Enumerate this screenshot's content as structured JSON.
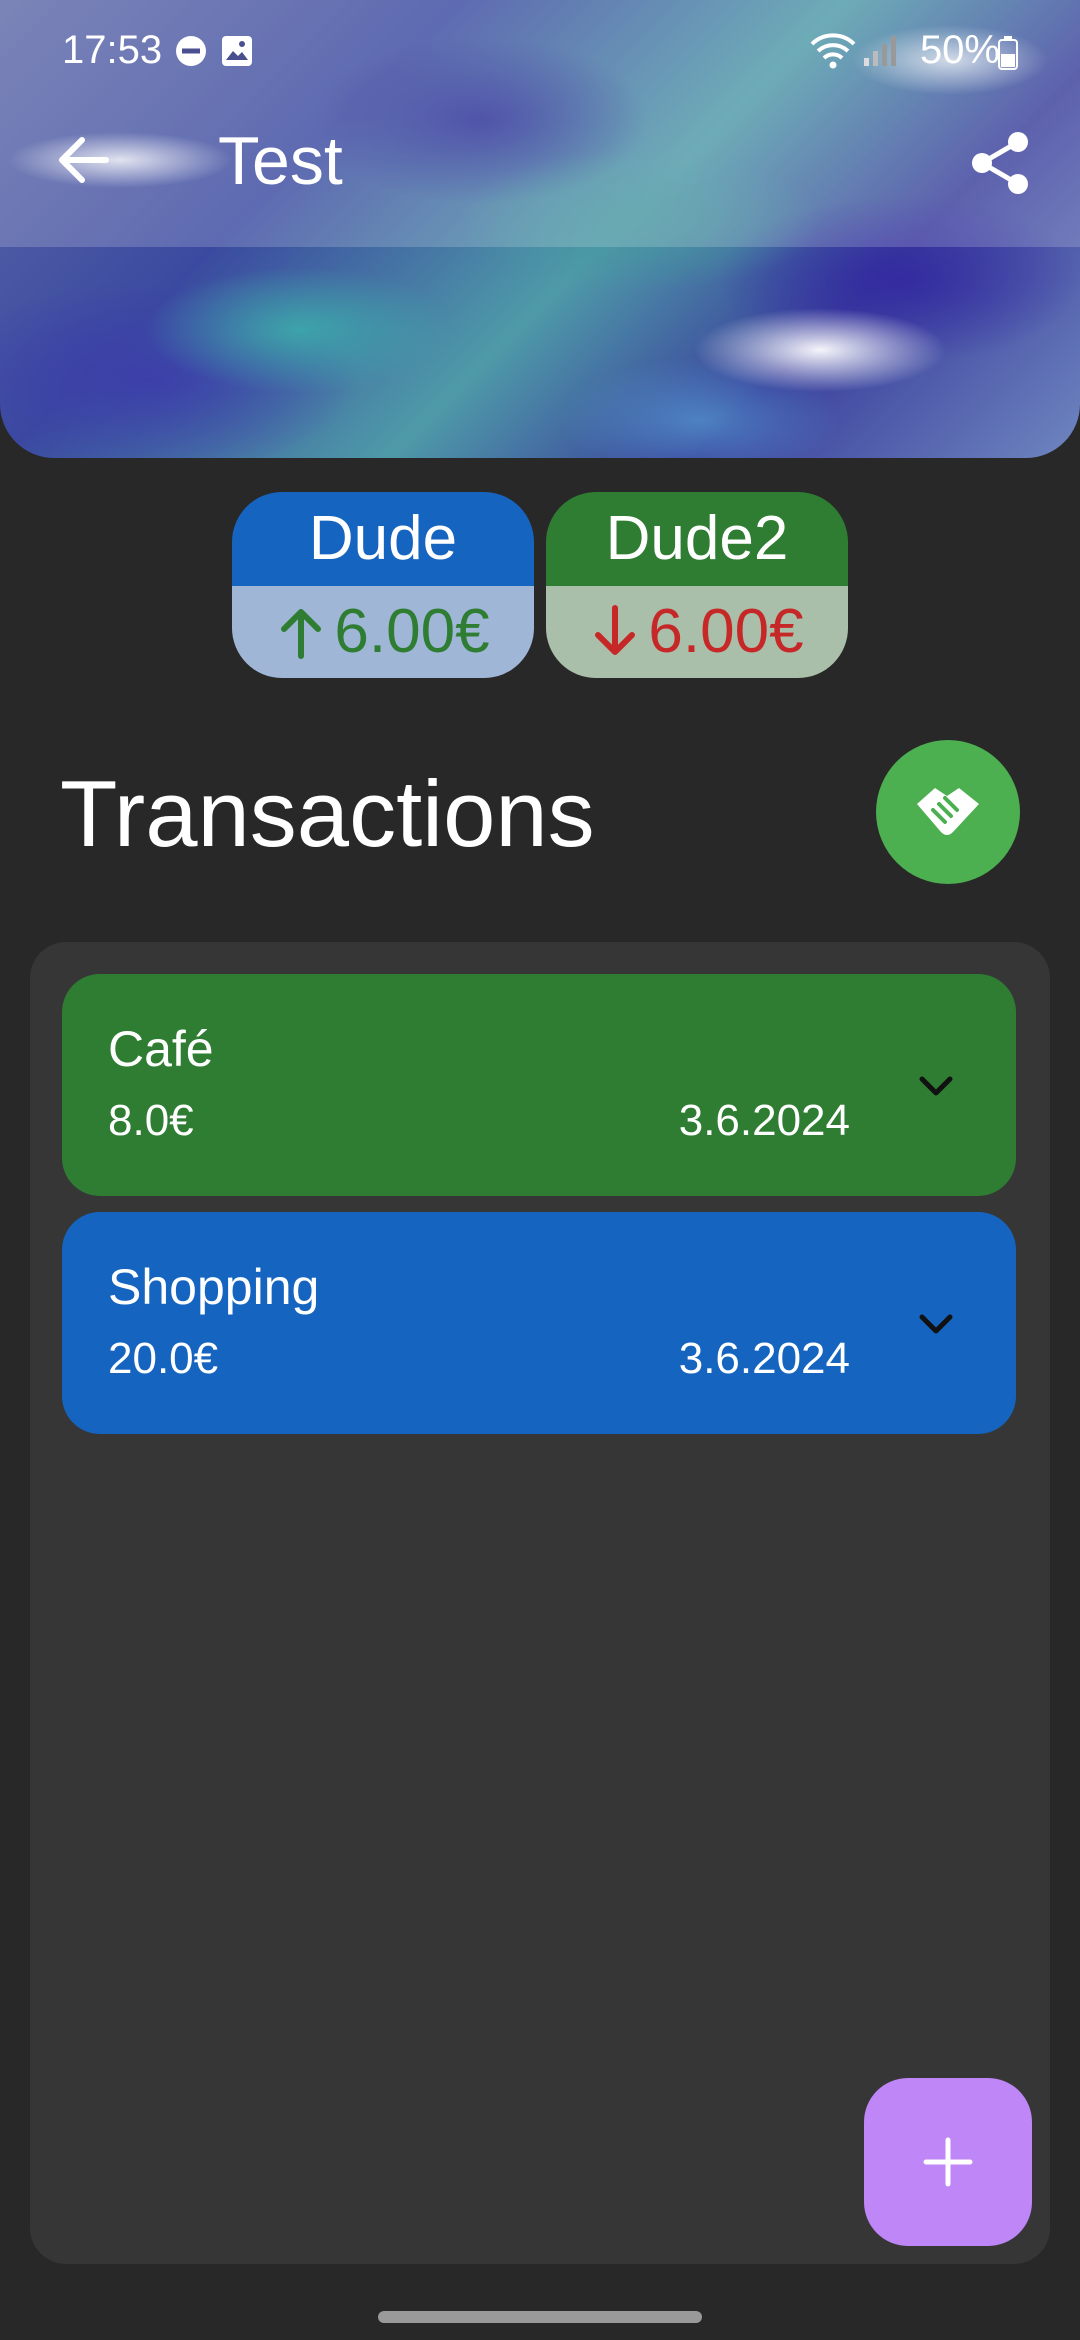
{
  "status_bar": {
    "time": "17:53",
    "battery": "50%",
    "icons": [
      "dnd-icon",
      "image-icon",
      "wifi-icon",
      "signal-icon",
      "battery-icon"
    ]
  },
  "app_bar": {
    "title": "Test",
    "back_icon": "arrow-left-icon",
    "share_icon": "share-icon"
  },
  "balances": [
    {
      "name": "Dude",
      "amount": "6.00€",
      "direction": "up",
      "name_color": "#1565c0",
      "amount_color": "#2e7d32"
    },
    {
      "name": "Dude2",
      "amount": "6.00€",
      "direction": "down",
      "name_color": "#2e7d32",
      "amount_color": "#c62828"
    }
  ],
  "section": {
    "title": "Transactions",
    "settle_icon": "handshake-icon",
    "settle_color": "#4caf50"
  },
  "transactions": [
    {
      "title": "Café",
      "amount": "8.0€",
      "date": "3.6.2024",
      "color": "#2e7d32"
    },
    {
      "title": "Shopping",
      "amount": "20.0€",
      "date": "3.6.2024",
      "color": "#1565c0"
    }
  ],
  "fab": {
    "icon": "plus-icon",
    "color": "#bf86f7"
  }
}
